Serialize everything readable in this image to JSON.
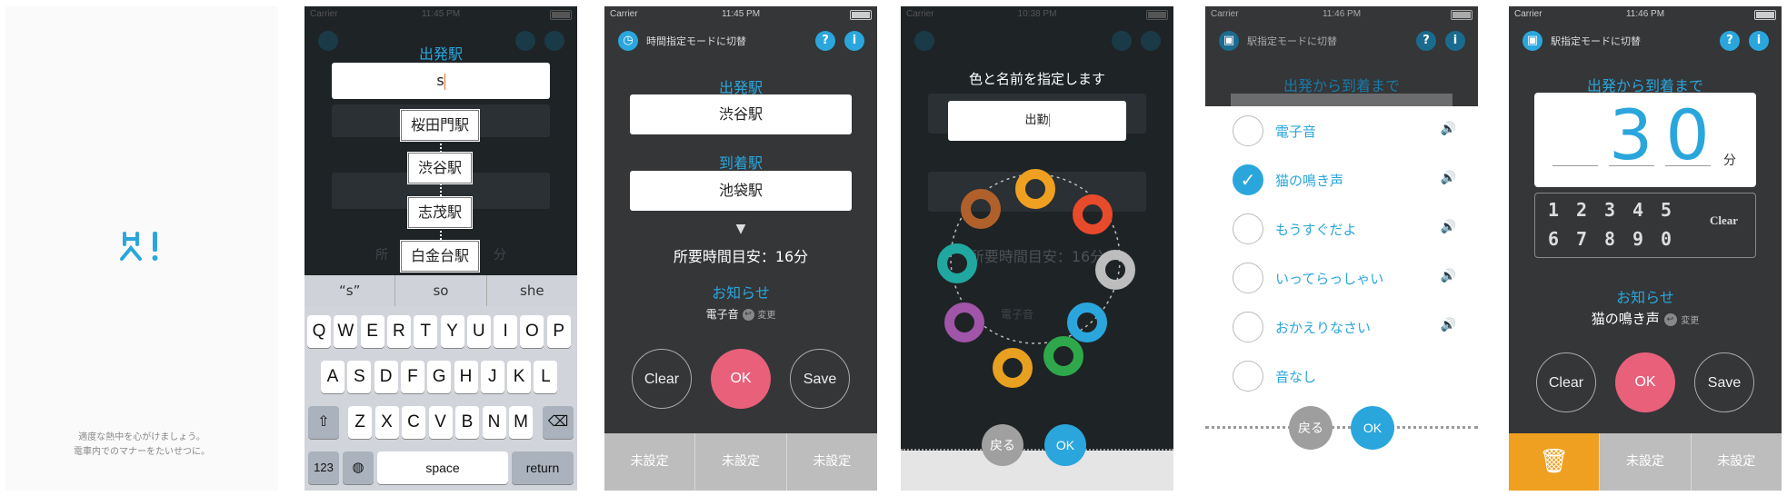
{
  "status": {
    "carrier": "Carrier",
    "wifi": "wifi-icon",
    "battery": "battery-icon",
    "times": [
      "11:45 PM",
      "11:45 PM",
      "10:38 PM",
      "11:46 PM",
      "11:46 PM"
    ]
  },
  "splash": {
    "line1": "適度な熱中を心がけましょう。",
    "line2": "電車内でのマナーをたいせつに。",
    "logo": "app-logo-icon"
  },
  "s2": {
    "label_depart": "出発駅",
    "input_value": "s",
    "candidates": [
      "桜田門駅",
      "渋谷駅",
      "志茂駅",
      "白金台駅"
    ],
    "bg_time_text": "所",
    "bg_time_suffix": "分",
    "suggestions": [
      "“s”",
      "so",
      "she"
    ],
    "keys_row1": [
      "Q",
      "W",
      "E",
      "R",
      "T",
      "Y",
      "U",
      "I",
      "O",
      "P"
    ],
    "keys_row2": [
      "A",
      "S",
      "D",
      "F",
      "G",
      "H",
      "J",
      "K",
      "L"
    ],
    "keys_row3": [
      "Z",
      "X",
      "C",
      "V",
      "B",
      "N",
      "M"
    ],
    "key_123": "123",
    "key_space": "space",
    "key_return": "return"
  },
  "s3": {
    "header": "時間指定モードに切替",
    "label_depart": "出発駅",
    "depart": "渋谷駅",
    "label_arrive": "到着駅",
    "arrive": "池袋駅",
    "arrow": "▼",
    "duration": "所要時間目安：16分",
    "notify_label": "お知らせ",
    "notify_sound": "電子音",
    "change": "変更",
    "clear": "Clear",
    "ok": "OK",
    "save": "Save",
    "tabs": [
      "未設定",
      "未設定",
      "未設定"
    ]
  },
  "s4": {
    "title": "色と名前を指定します",
    "input_value": "出勤",
    "colors": [
      "#f0a020",
      "#e84a2c",
      "#bdbdbd",
      "#2aa6dc",
      "#2ea84a",
      "#e8a020",
      "#a055a8",
      "#20a8a0",
      "#b0602a"
    ],
    "bg_time_text": "所要時間目安：16分",
    "bg_sound": "電子音",
    "back": "戻る",
    "ok": "OK"
  },
  "s5": {
    "header": "駅指定モードに切替",
    "label": "出発から到着まで",
    "options": [
      "電子音",
      "猫の鳴き声",
      "もうすぐだよ",
      "いってらっしゃい",
      "おかえりなさい",
      "音なし"
    ],
    "selected_index": 1,
    "back": "戻る",
    "ok": "OK"
  },
  "s6": {
    "header": "駅指定モードに切替",
    "label": "出発から到着まで",
    "minutes": "30",
    "unit": "分",
    "pad_row1": [
      "1",
      "2",
      "3",
      "4",
      "5"
    ],
    "pad_row2": [
      "6",
      "7",
      "8",
      "9",
      "0"
    ],
    "pad_clear": "Clear",
    "notify_label": "お知らせ",
    "notify_sound": "猫の鳴き声",
    "change": "変更",
    "clear": "Clear",
    "ok": "OK",
    "save": "Save",
    "tabs": [
      "未設定",
      "未設定"
    ],
    "trash": "trash-icon"
  }
}
